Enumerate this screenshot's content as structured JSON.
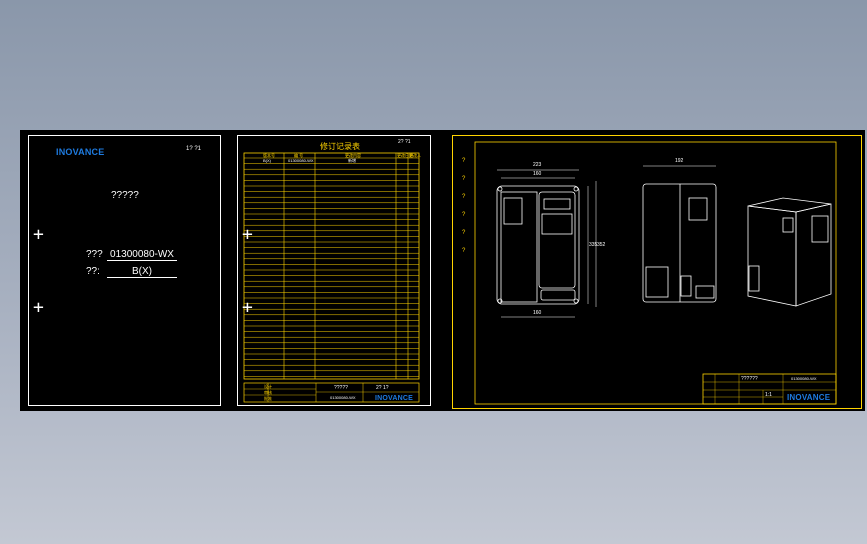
{
  "cover": {
    "logo": "INOVANCE",
    "page_tag": "1? ?1",
    "title": "?????",
    "code_label": "???",
    "code_value": "01300080-WX",
    "version_label": "??:",
    "version_value": "B(X)"
  },
  "revision": {
    "title": "修订记录表",
    "page_tag": "2? ?1",
    "header_cols": [
      "版本号",
      "编 号",
      "更改内容",
      "更改日期",
      "更改人"
    ],
    "first_row": [
      "B(X)",
      "01300080-WX",
      "新增",
      "",
      ""
    ],
    "titleblock_left": [
      "设计",
      "审核",
      "批准"
    ],
    "titleblock_code": "01300080-WX",
    "titleblock_mid": "?????",
    "titleblock_page": "2? 1?",
    "logo": "INOVANCE"
  },
  "drawing": {
    "left_labels": [
      "?",
      "?",
      "?",
      "?",
      "?",
      "?"
    ],
    "dim_top_front": "223",
    "dim_inner_front": "160",
    "dim_height": "335",
    "dim_height2": "352",
    "dim_bottom": "160",
    "dim_side": "192",
    "titleblock_name": "??????",
    "titleblock_code": "01300080-WX",
    "titleblock_scale": "1:1",
    "logo": "INOVANCE"
  },
  "colors": {
    "background_top": "#8a97aa",
    "canvas": "#000000",
    "sheet_border": "#ffffff",
    "drawing_lines": "#ffd400",
    "logo": "#1e7be0"
  }
}
